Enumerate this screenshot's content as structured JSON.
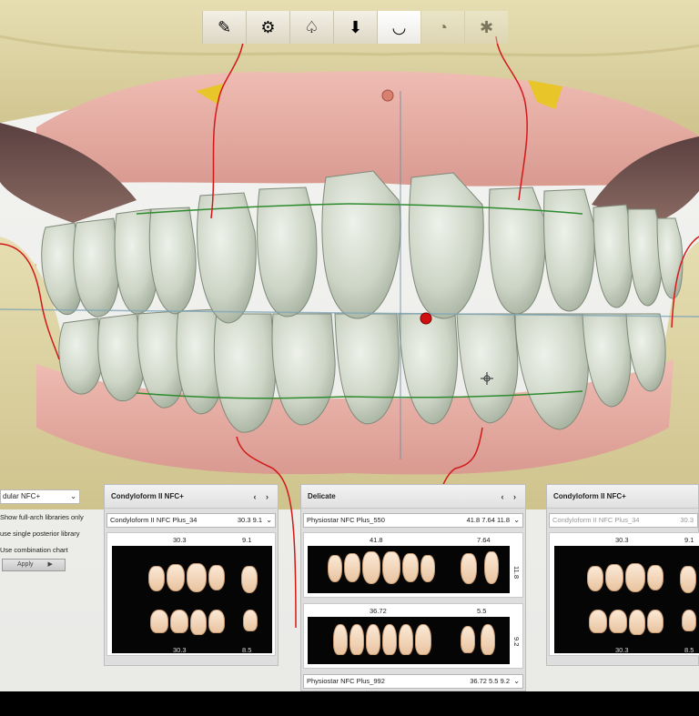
{
  "toolbar": {
    "buttons": [
      {
        "icon": "scalpel-icon",
        "glyph": "✎"
      },
      {
        "icon": "tooth-tools-icon",
        "glyph": "⚙"
      },
      {
        "icon": "molar-icon",
        "glyph": "♤"
      },
      {
        "icon": "tooth-download-icon",
        "glyph": "⬇"
      },
      {
        "icon": "jaw-setup-icon",
        "glyph": "◡"
      },
      {
        "icon": "crown-icon",
        "glyph": "◔"
      },
      {
        "icon": "gear-tooth-icon",
        "glyph": "✱"
      }
    ]
  },
  "left_panel": {
    "library_select": "dular NFC+",
    "options": [
      "Show full-arch libraries only",
      "use single posterior library",
      "Use combination chart"
    ],
    "apply_label": "Apply"
  },
  "panels": [
    {
      "title": "Condyloform II NFC+",
      "upper": {
        "name": "Condyloform II NFC Plus_34",
        "vals": "30.3  9.1"
      },
      "upper_labels": [
        "30.3",
        "9.1"
      ],
      "lower_labels": [
        "30.3",
        "8.5"
      ]
    },
    {
      "title": "Delicate",
      "upper": {
        "name": "Physiostar NFC Plus_550",
        "vals": "41.8  7.64  11.8"
      },
      "upper_labels": [
        "41.8",
        "7.64",
        "11.8"
      ],
      "lower_labels": [
        "36.72",
        "5.5",
        "9.2"
      ],
      "lower": {
        "name": "Physiostar NFC Plus_992",
        "vals": "36.72  5.5  9.2"
      }
    },
    {
      "title": "Condyloform II NFC+",
      "upper": {
        "name": "Condyloform II NFC Plus_34",
        "vals": "30.3"
      },
      "upper_labels": [
        "30.3",
        "9.1"
      ],
      "lower_labels": [
        "30.3",
        "8.5"
      ]
    }
  ],
  "colors": {
    "base_tan": "#ddd3a3",
    "gum_pink": "#eab0a8",
    "tooth_grey": "#cdd5c6",
    "margin_red": "#d21818",
    "marker_red": "#d01010"
  }
}
